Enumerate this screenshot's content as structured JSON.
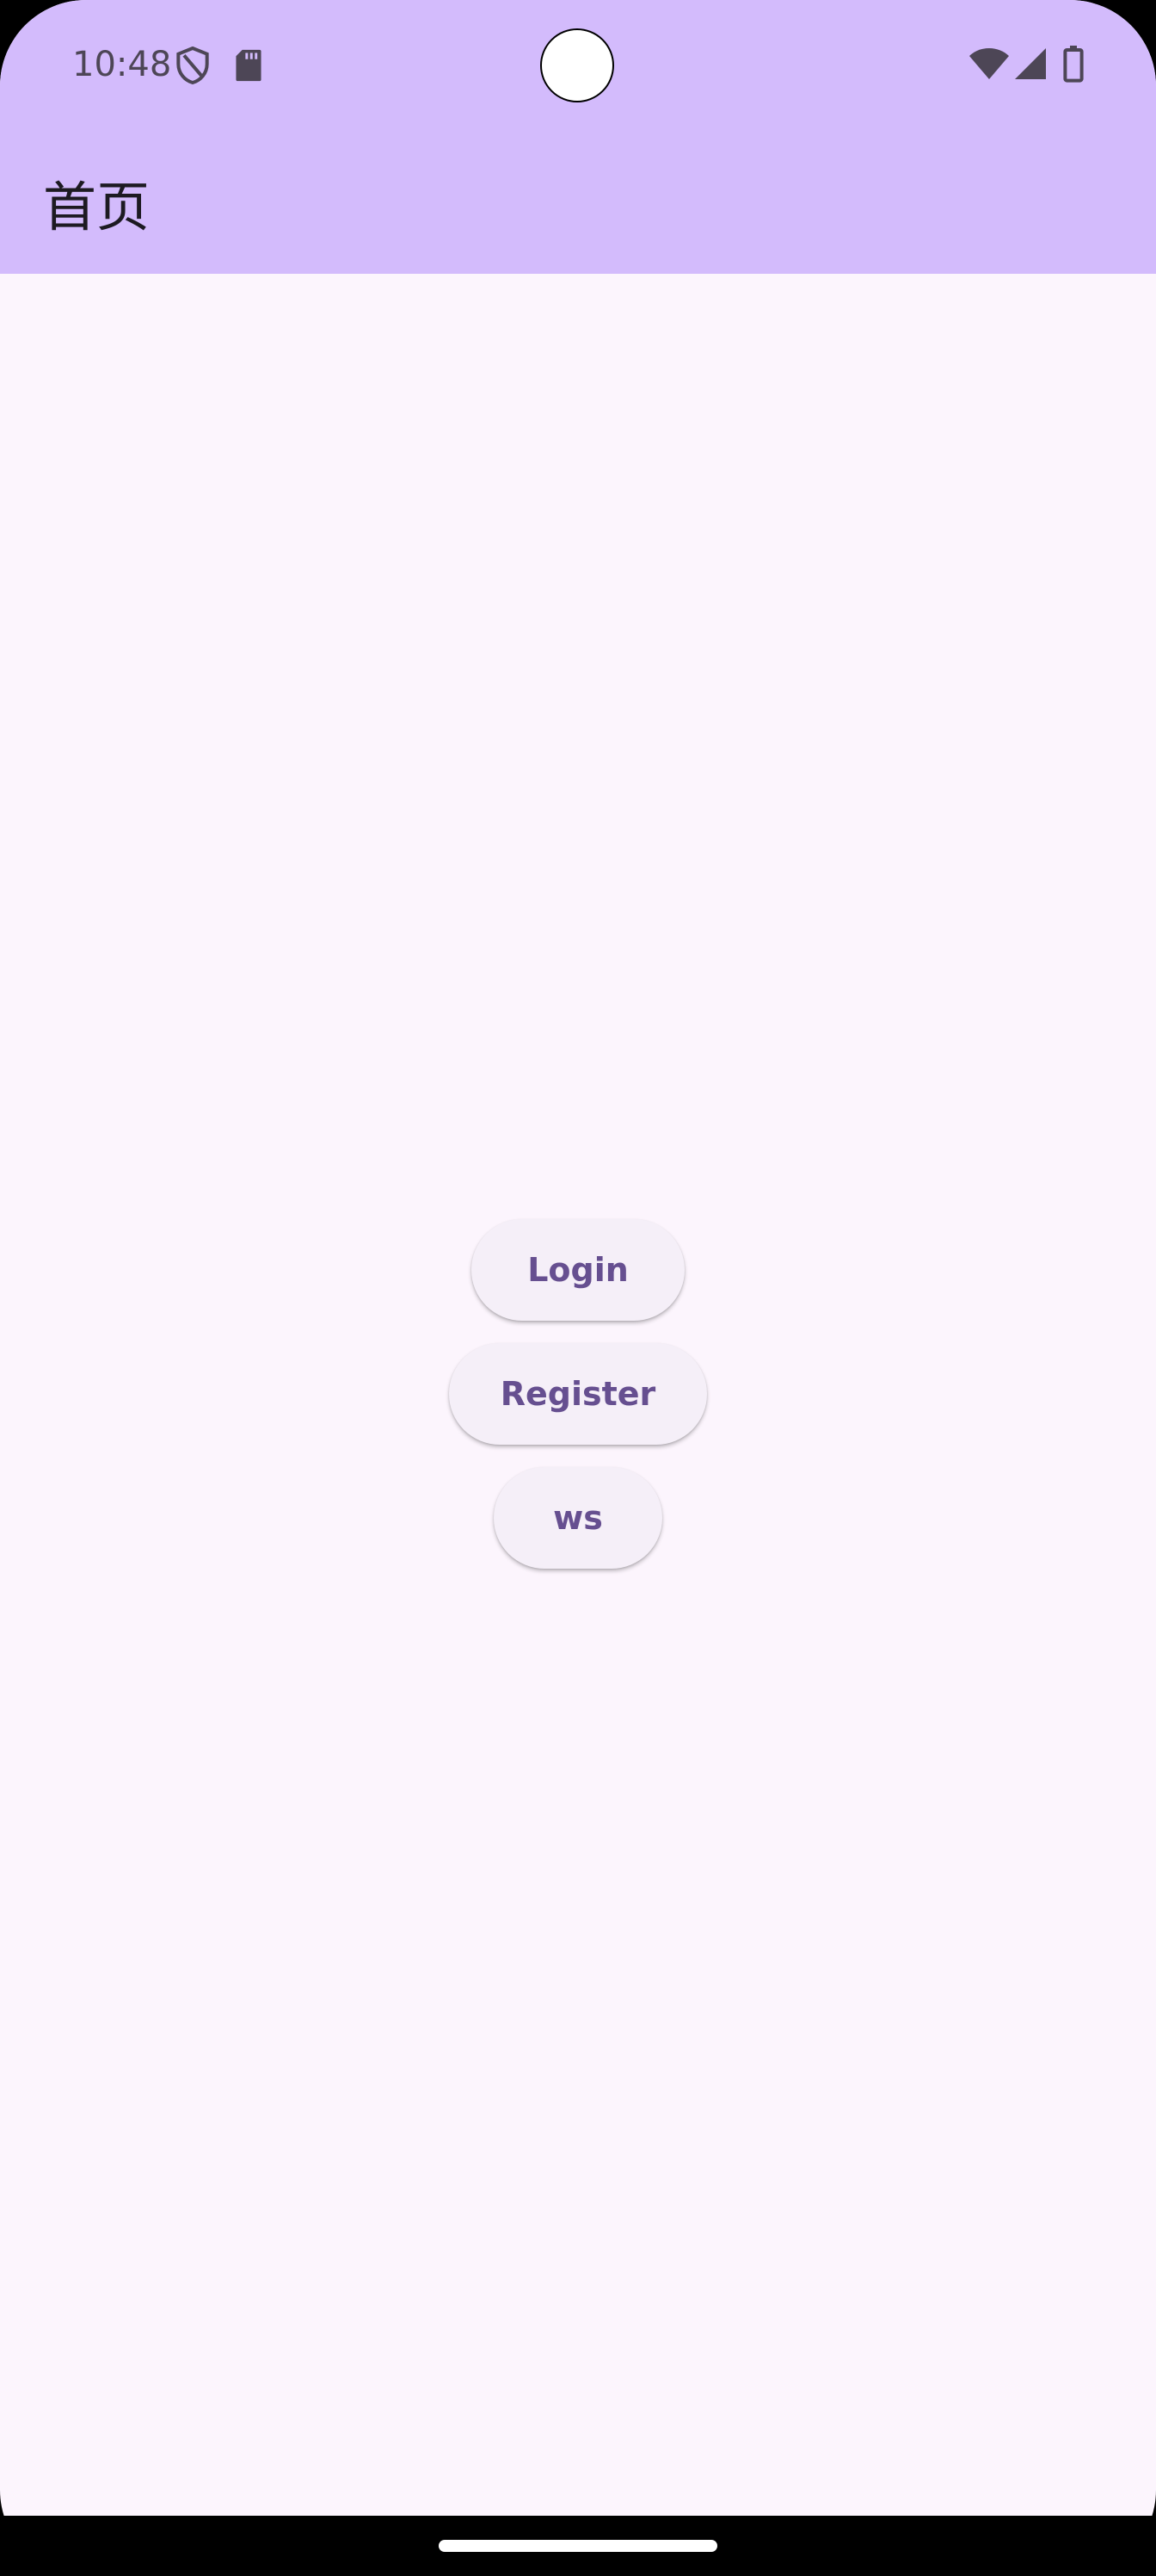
{
  "status_bar": {
    "time": "10:48",
    "icons": {
      "left": [
        "shield-icon",
        "sd-card-icon"
      ],
      "right": [
        "wifi-icon",
        "cellular-signal-icon",
        "battery-icon"
      ]
    }
  },
  "app_bar": {
    "title": "首页"
  },
  "main": {
    "buttons": [
      {
        "label": "Login"
      },
      {
        "label": "Register"
      },
      {
        "label": "ws"
      }
    ]
  },
  "colors": {
    "app_bar_background": "#d3bbfc",
    "page_background": "#fcf5fd",
    "button_background": "#f5eff8",
    "button_text": "#664f90",
    "status_icon": "#4d4656"
  }
}
